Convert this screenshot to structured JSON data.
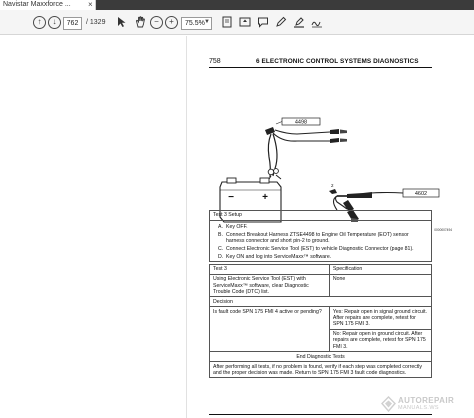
{
  "tab": {
    "title": "Navistar Maxxforce ...",
    "close_glyph": "×"
  },
  "toolbar": {
    "current_page": "762",
    "total_pages": "/ 1329",
    "zoom": "75.5%",
    "icons": [
      "up-arrow-icon",
      "down-arrow-icon",
      "cursor-icon",
      "hand-icon",
      "zoom-out-icon",
      "zoom-in-icon",
      "fit-page-icon",
      "scroll-mode-icon",
      "comment-icon",
      "pen-icon",
      "highlight-icon",
      "sign-icon"
    ]
  },
  "page": {
    "number": "758",
    "section": "6  ELECTRONIC CONTROL SYSTEMS DIAGNOSTICS",
    "diagram": {
      "label_top": "4498",
      "label_right": "4602",
      "battery_minus": "−",
      "battery_plus": "+",
      "figure_code": "0000007494"
    },
    "setup": {
      "header": "Test 3 Setup",
      "steps": [
        {
          "letter": "A.",
          "text": "Key OFF."
        },
        {
          "letter": "B.",
          "text": "Connect Breakout Harness ZTSE4498 to Engine Oil Temperature (EOT) sensor harness connector and short pin-2 to ground."
        },
        {
          "letter": "C.",
          "text": "Connect Electronic Service Tool (EST) to vehicle Diagnostic Connector (page 81)."
        },
        {
          "letter": "D.",
          "text": "Key ON and log into ServiceMaxx™ software."
        }
      ]
    },
    "test": {
      "col1_header": "Test 3",
      "col2_header": "Specification",
      "procedure": "Using Electronic Service Tool (EST) with ServiceMaxx™ software, clear Diagnostic Trouble Code (DTC) list.",
      "specification": "None",
      "decision_header": "Decision",
      "question": "Is fault code SPN 175 FMI 4 active or pending?",
      "yes_text": "Yes: Repair open in signal ground circuit. After repairs are complete, retest for SPN 175 FMI 3.",
      "no_text": "No: Repair open in ground circuit. After repairs are complete, retest for SPN 175 FMI 3.",
      "end_header": "End Diagnostic Tests",
      "end_text": "After performing all tests, if no problem is found, verify if each step was completed correctly and the proper decision was made. Return to SPN 175 FMI 3 fault code diagnostics."
    }
  },
  "watermark": {
    "line1": "AUTOREPAIR",
    "line2": "MANUALS.WS"
  }
}
